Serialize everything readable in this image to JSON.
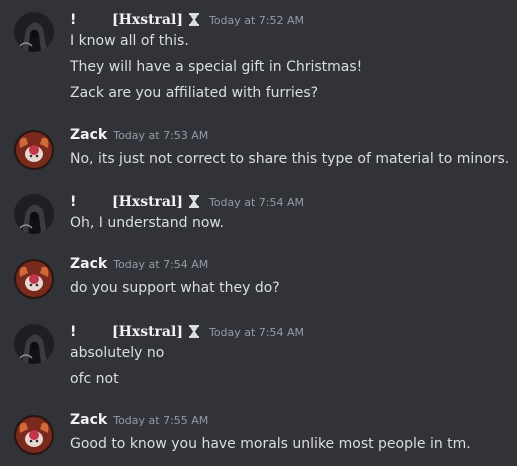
{
  "messages": [
    {
      "avatar": "hooded-figure-avatar",
      "bang": "!",
      "author": "[Hxstral]",
      "badge": "hourglass-icon",
      "timestamp": "Today at 7:52 AM",
      "lines": [
        "I know all of this.",
        "They will have a special gift in Christmas!",
        "Zack are you affiliated with furries?"
      ]
    },
    {
      "avatar": "red-character-avatar",
      "author": "Zack",
      "timestamp": "Today at 7:53 AM",
      "lines": [
        "No, its just not correct to share this type of material to minors."
      ]
    },
    {
      "avatar": "hooded-figure-avatar",
      "bang": "!",
      "author": "[Hxstral]",
      "badge": "hourglass-icon",
      "timestamp": "Today at 7:54 AM",
      "lines": [
        "Oh, I understand now."
      ]
    },
    {
      "avatar": "red-character-avatar",
      "author": "Zack",
      "timestamp": "Today at 7:54 AM",
      "lines": [
        "do you support what they do?"
      ]
    },
    {
      "avatar": "hooded-figure-avatar",
      "bang": "!",
      "author": "[Hxstral]",
      "badge": "hourglass-icon",
      "timestamp": "Today at 7:54 AM",
      "lines": [
        "absolutely no",
        "ofc not"
      ]
    },
    {
      "avatar": "red-character-avatar",
      "author": "Zack",
      "timestamp": "Today at 7:55 AM",
      "lines": [
        "Good to know you have morals unlike most people in tm."
      ]
    }
  ]
}
